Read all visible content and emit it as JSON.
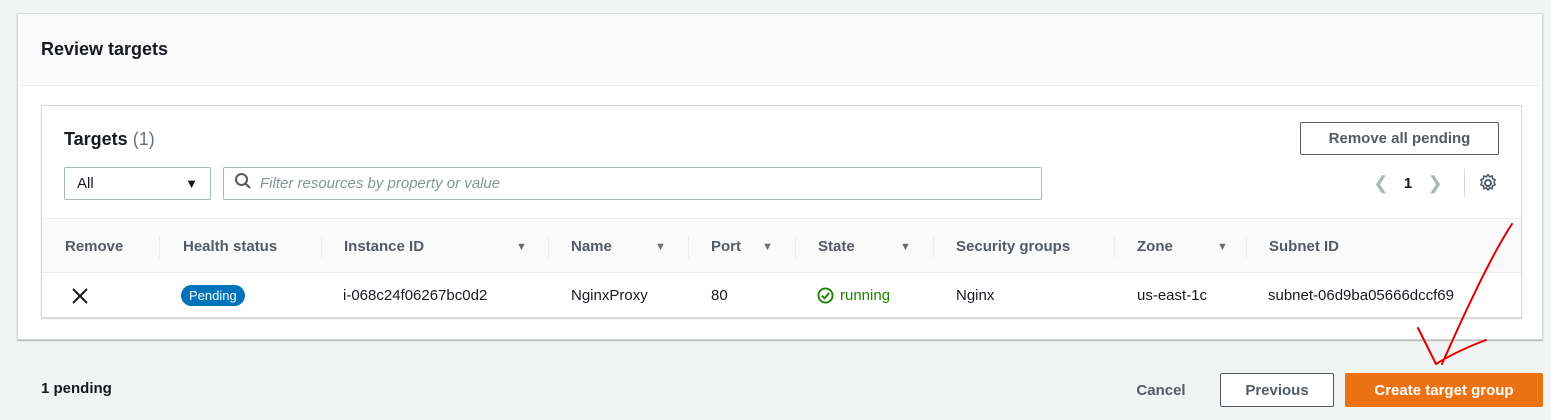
{
  "section": {
    "title": "Review targets"
  },
  "targets": {
    "title": "Targets",
    "count": "(1)",
    "remove_all_label": "Remove all pending",
    "select_value": "All",
    "filter_placeholder": "Filter resources by property or value",
    "page": "1"
  },
  "table": {
    "headers": {
      "remove": "Remove",
      "health": "Health status",
      "instance": "Instance ID",
      "name": "Name",
      "port": "Port",
      "state": "State",
      "sg": "Security groups",
      "zone": "Zone",
      "subnet": "Subnet ID"
    },
    "rows": [
      {
        "health": "Pending",
        "instance": "i-068c24f06267bc0d2",
        "name": "NginxProxy",
        "port": "80",
        "state": "running",
        "sg": "Nginx",
        "zone": "us-east-1c",
        "subnet": "subnet-06d9ba05666dccf69"
      }
    ]
  },
  "footer": {
    "pending": "1 pending",
    "cancel_label": "Cancel",
    "previous_label": "Previous",
    "create_label": "Create target group"
  },
  "colors": {
    "primary": "#ec7211",
    "badge": "#0073bb",
    "running": "#1d8102",
    "annotation": "#e00000"
  }
}
